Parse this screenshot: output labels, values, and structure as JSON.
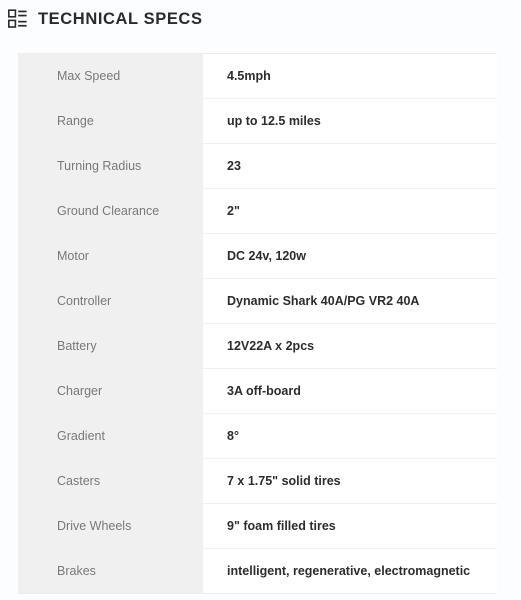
{
  "header": {
    "icon": "spec-list-icon",
    "title": "TECHNICAL SPECS"
  },
  "spec_table": {
    "rows": [
      {
        "label": "Max Speed",
        "value": "4.5mph"
      },
      {
        "label": "Range",
        "value": "up to 12.5 miles"
      },
      {
        "label": "Turning Radius",
        "value": "23"
      },
      {
        "label": "Ground Clearance",
        "value": "2\""
      },
      {
        "label": "Motor",
        "value": "DC 24v, 120w"
      },
      {
        "label": "Controller",
        "value": "Dynamic Shark 40A/PG VR2 40A"
      },
      {
        "label": "Battery",
        "value": "12V22A x 2pcs"
      },
      {
        "label": "Charger",
        "value": "3A off-board"
      },
      {
        "label": "Gradient",
        "value": "8°"
      },
      {
        "label": "Casters",
        "value": "7 x 1.75\" solid tires"
      },
      {
        "label": "Drive Wheels",
        "value": "9\" foam filled tires"
      },
      {
        "label": "Brakes",
        "value": "intelligent, regenerative, electromagnetic"
      }
    ]
  },
  "colors": {
    "page_background": "#fbfdfe",
    "label_cell_background": "#f0f0f0",
    "value_cell_background": "#ffffff",
    "label_text": "#797979",
    "value_text": "#2d2d2d",
    "title_text": "#2b2b2b",
    "row_divider": "#f0f0f0"
  }
}
